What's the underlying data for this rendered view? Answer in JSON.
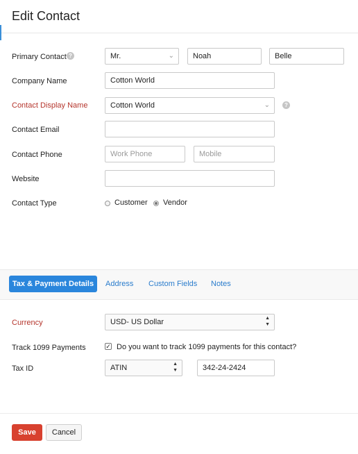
{
  "title": "Edit Contact",
  "form": {
    "primary_contact": {
      "label": "Primary Contact",
      "salutation": "Mr.",
      "first_name": "Noah",
      "last_name": "Belle"
    },
    "company_name": {
      "label": "Company Name",
      "value": "Cotton World"
    },
    "display_name": {
      "label": "Contact Display Name",
      "value": "Cotton World"
    },
    "email": {
      "label": "Contact Email",
      "value": ""
    },
    "phone": {
      "label": "Contact Phone",
      "work_placeholder": "Work Phone",
      "mobile_placeholder": "Mobile"
    },
    "website": {
      "label": "Website",
      "value": ""
    },
    "contact_type": {
      "label": "Contact Type",
      "options": [
        "Customer",
        "Vendor"
      ],
      "selected": "Vendor"
    }
  },
  "tabs": [
    {
      "label": "Tax & Payment Details",
      "active": true
    },
    {
      "label": "Address",
      "active": false
    },
    {
      "label": "Custom Fields",
      "active": false
    },
    {
      "label": "Notes",
      "active": false
    }
  ],
  "tax": {
    "currency": {
      "label": "Currency",
      "value": "USD- US Dollar"
    },
    "track1099": {
      "label": "Track 1099 Payments",
      "checkbox_text": "Do you want to track 1099 payments for this contact?",
      "checked": true
    },
    "tax_id": {
      "label": "Tax ID",
      "type": "ATIN",
      "value": "342-24-2424"
    }
  },
  "actions": {
    "save": "Save",
    "cancel": "Cancel"
  },
  "colors": {
    "accent": "#2a86dc",
    "required_label": "#b5352c",
    "save_button": "#d8412f"
  }
}
